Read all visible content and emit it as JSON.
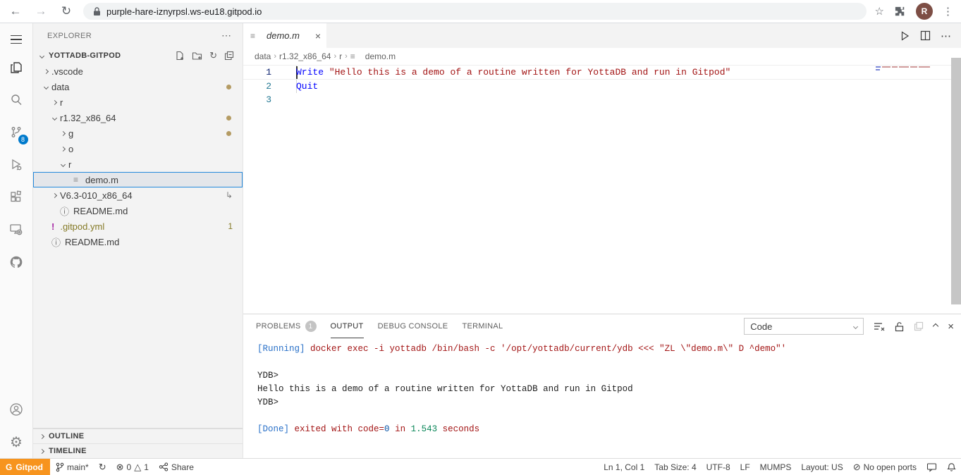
{
  "browser": {
    "url": "purple-hare-iznyrpsl.ws-eu18.gitpod.io",
    "avatar": "R"
  },
  "glyphs": {
    "back": "←",
    "forward": "→",
    "reload": "↻",
    "star": "☆",
    "kebab": "⋮",
    "more": "⋯",
    "close": "×",
    "file_lines": "≡",
    "info": "ⓘ",
    "warn": "!",
    "symlink": "↳",
    "sync": "↻",
    "error": "⊗",
    "warning": "△",
    "no_ports": "⊘",
    "run": "▷",
    "gear": "⚙",
    "refresh": "↻"
  },
  "activity_bar": {
    "scm_badge": "8"
  },
  "sidebar": {
    "title": "EXPLORER",
    "section": "YOTTADB-GITPOD",
    "tree": [
      {
        "label": ".vscode"
      },
      {
        "label": "data"
      },
      {
        "label": "r"
      },
      {
        "label": "r1.32_x86_64"
      },
      {
        "label": "g"
      },
      {
        "label": "o"
      },
      {
        "label": "r"
      },
      {
        "label": "demo.m"
      },
      {
        "label": "V6.3-010_x86_64"
      },
      {
        "label": "README.md"
      },
      {
        "label": ".gitpod.yml",
        "badge": "1"
      },
      {
        "label": "README.md"
      }
    ],
    "bottom_sections": [
      "OUTLINE",
      "TIMELINE"
    ]
  },
  "editor": {
    "tab": "demo.m",
    "breadcrumbs": [
      "data",
      "r1.32_x86_64",
      "r",
      "demo.m"
    ],
    "code_lines": [
      {
        "num": "1",
        "keyword": "Write ",
        "string": "\"Hello this is a demo of a routine written for YottaDB and run in Gitpod\""
      },
      {
        "num": "2",
        "keyword": "Quit"
      },
      {
        "num": "3"
      }
    ]
  },
  "panel": {
    "tabs": [
      {
        "label": "PROBLEMS",
        "badge": "1"
      },
      {
        "label": "OUTPUT"
      },
      {
        "label": "DEBUG CONSOLE"
      },
      {
        "label": "TERMINAL"
      }
    ],
    "channel": "Code",
    "output": {
      "running_prefix": "[Running]",
      "running_command": " docker exec -i yottadb /bin/bash -c '/opt/yottadb/current/ydb <<< \"ZL \\\"demo.m\\\" D ^demo\"'",
      "prompt1": "YDB>",
      "hello_line": "Hello this is a demo of a routine written for YottaDB and run in Gitpod",
      "prompt2": "YDB>",
      "done_prefix": "[Done]",
      "done_mid1": " exited with code=",
      "done_zero": "0",
      "done_mid2": " in ",
      "done_time": "1.543",
      "done_suffix": " seconds"
    }
  },
  "status_bar": {
    "gitpod_logo": "G",
    "gitpod_label": "Gitpod",
    "branch": "main*",
    "errors": "0",
    "warnings": "1",
    "share": "Share",
    "cursor": "Ln 1, Col 1",
    "tab_size": "Tab Size: 4",
    "encoding": "UTF-8",
    "eol": "LF",
    "language": "MUMPS",
    "layout": "Layout: US",
    "ports": "No open ports"
  },
  "colors": {
    "gitpod_orange": "#f7941e",
    "scm_badge_blue": "#007acc",
    "keyword_blue": "#0000ff",
    "string_red": "#a31515",
    "log_label_blue": "#2970c8",
    "log_command_red": "#a31515",
    "log_number_teal": "#098658",
    "modified_dot_tan": "#b49b63",
    "warn_file_olive": "#857a27",
    "selection_border_blue": "#2488db"
  }
}
